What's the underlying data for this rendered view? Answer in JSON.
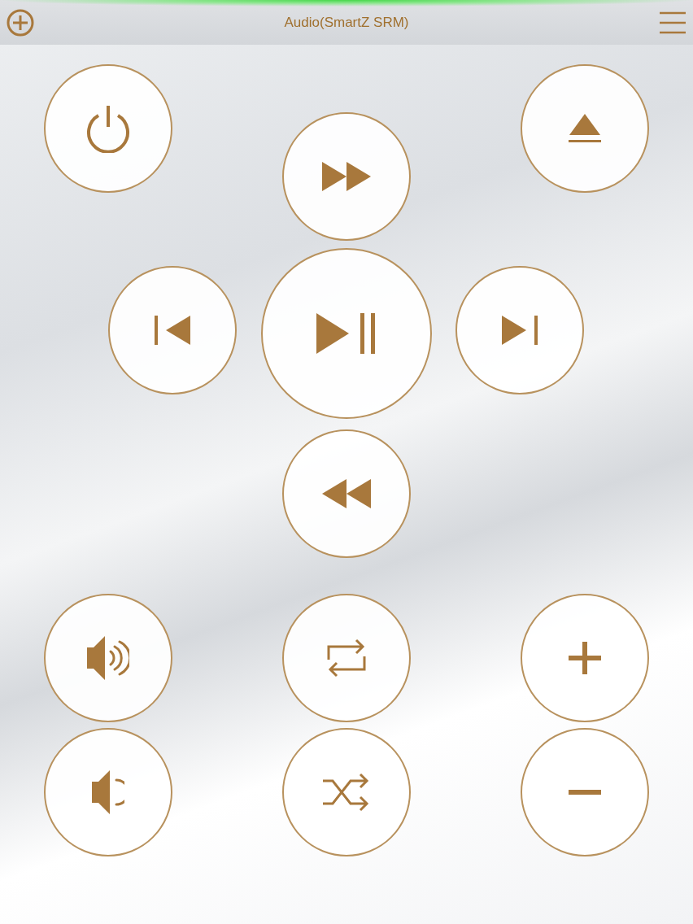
{
  "header": {
    "title": "Audio(SmartZ SRM)"
  },
  "pad": [
    {
      "kind": "power"
    },
    {
      "kind": "eject"
    },
    {
      "kind": "fast_forward"
    },
    {
      "kind": "previous"
    },
    {
      "kind": "play_pause"
    },
    {
      "kind": "next"
    },
    {
      "kind": "rewind"
    }
  ],
  "bottom_rows": [
    [
      {
        "kind": "volume_up"
      },
      {
        "kind": "repeat"
      },
      {
        "kind": "plus"
      }
    ],
    [
      {
        "kind": "volume_down"
      },
      {
        "kind": "shuffle"
      },
      {
        "kind": "minus"
      }
    ]
  ]
}
